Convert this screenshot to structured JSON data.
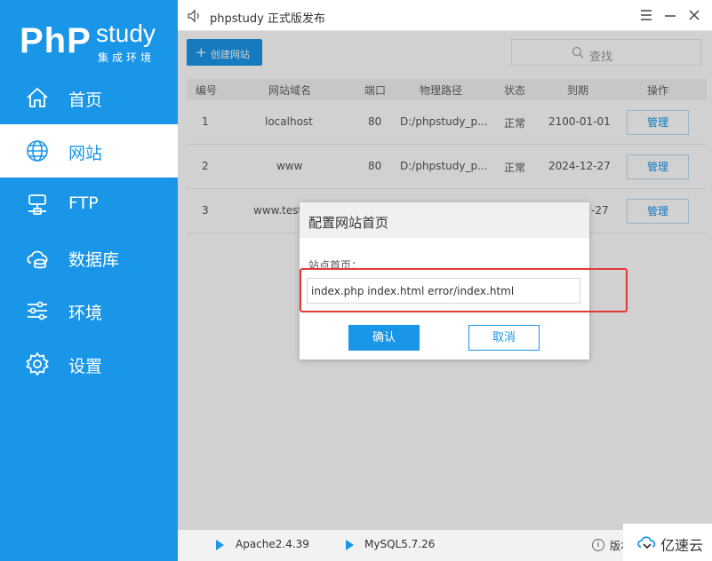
{
  "sidebar": {
    "logo": {
      "php": "PhP",
      "study": "study",
      "subtitle": "集成环境"
    },
    "items": [
      {
        "label": "首页",
        "icon": "home-icon"
      },
      {
        "label": "网站",
        "icon": "globe-icon",
        "active": true
      },
      {
        "label": "FTP",
        "icon": "server-icon"
      },
      {
        "label": "数据库",
        "icon": "database-icon"
      },
      {
        "label": "环境",
        "icon": "sliders-icon"
      },
      {
        "label": "设置",
        "icon": "gear-icon"
      }
    ]
  },
  "titlebar": {
    "title": "phpstudy 正式版发布",
    "icon": "speaker-icon"
  },
  "toolbar": {
    "create_label": "创建网站",
    "search_placeholder": "查找"
  },
  "table": {
    "columns": [
      "编号",
      "网站域名",
      "端口",
      "物理路径",
      "状态",
      "到期",
      "操作"
    ],
    "rows": [
      {
        "id": "1",
        "domain": "localhost",
        "port": "80",
        "path": "D:/phpstudy_p...",
        "status": "正常",
        "expire": "2100-01-01",
        "action": "管理"
      },
      {
        "id": "2",
        "domain": "www",
        "port": "80",
        "path": "D:/phpstudy_p...",
        "status": "正常",
        "expire": "2024-12-27",
        "action": "管理"
      },
      {
        "id": "3",
        "domain": "www.test",
        "port": "",
        "path": "",
        "status": "",
        "expire": "-27",
        "action": "管理"
      }
    ]
  },
  "statusbar": {
    "apache": "Apache2.4.39",
    "mysql": "MySQL5.7.26",
    "version": "版本"
  },
  "dialog": {
    "title": "配置网站首页",
    "label": "站点首页：",
    "input_value": "index.php index.html error/index.html",
    "ok_label": "确认",
    "cancel_label": "取消"
  },
  "watermark": {
    "text": "亿速云"
  },
  "colors": {
    "accent": "#1a96e8",
    "highlight": "#e53935"
  }
}
